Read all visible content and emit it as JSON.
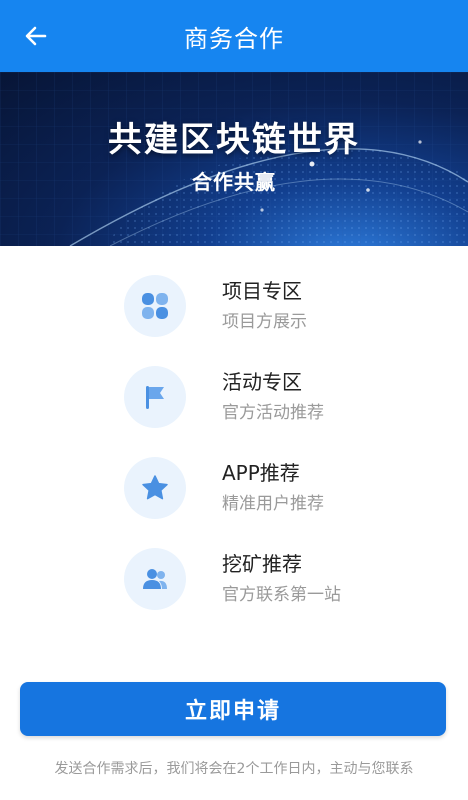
{
  "header": {
    "title": "商务合作",
    "back_icon": "arrow-left-icon",
    "background": "#1685f0"
  },
  "banner": {
    "title": "共建区块链世界",
    "subtitle": "合作共赢"
  },
  "items": [
    {
      "title": "项目专区",
      "subtitle": "项目方展示",
      "icon": "grid-four-icon"
    },
    {
      "title": "活动专区",
      "subtitle": "官方活动推荐",
      "icon": "flag-icon"
    },
    {
      "title": "APP推荐",
      "subtitle": "精准用户推荐",
      "icon": "star-icon"
    },
    {
      "title": "挖矿推荐",
      "subtitle": "官方联系第一站",
      "icon": "users-icon"
    }
  ],
  "apply_button": {
    "label": "立即申请",
    "color": "#1675e0"
  },
  "footnote": "发送合作需求后，我们将会在2个工作日内，主动与您联系",
  "colors": {
    "icon_bg": "#eaf3fd",
    "icon_fill": "#4a90e2"
  }
}
